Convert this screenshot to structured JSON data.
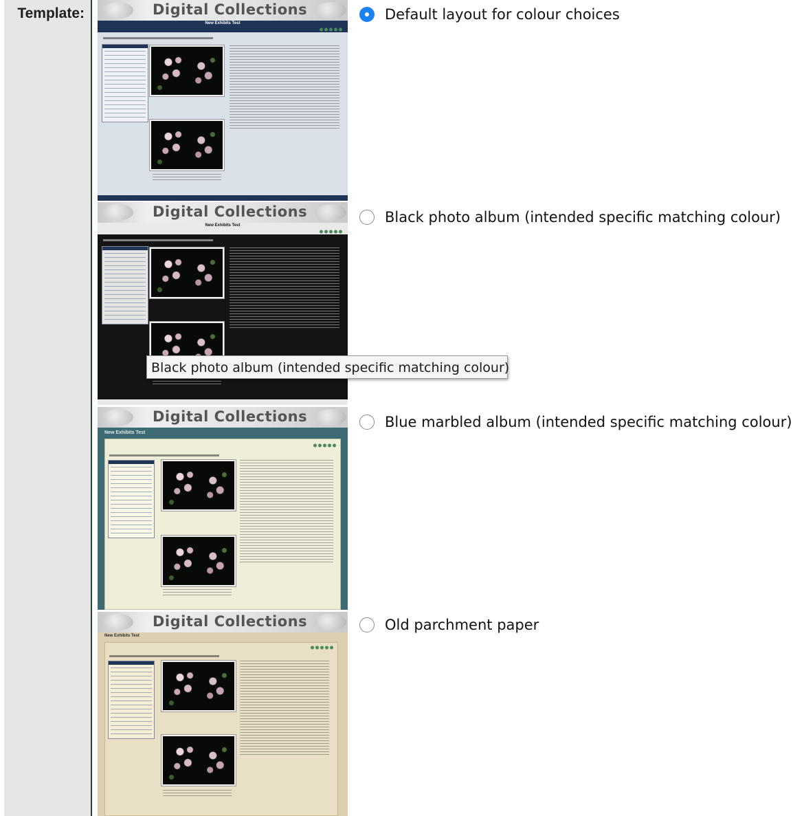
{
  "form": {
    "label": "Template:"
  },
  "thumbnail": {
    "banner_title": "Digital Collections",
    "exhibit_title": "New Exhibits Test"
  },
  "options": [
    {
      "label": "Default layout for colour choices",
      "selected": true
    },
    {
      "label": "Black photo album (intended specific matching colour)",
      "selected": false
    },
    {
      "label": "Blue marbled album (intended specific matching colour)",
      "selected": false
    },
    {
      "label": "Old parchment paper",
      "selected": false
    }
  ],
  "tooltip": {
    "text": "Black photo album (intended specific matching colour)"
  },
  "colors": {
    "radio_selected": "#1b82f3",
    "default_nav": "#1e3558",
    "black_album_bg": "#111111",
    "blue_marbled_bg": "#3e6a73",
    "parchment_bg": "#dbcfb0"
  }
}
